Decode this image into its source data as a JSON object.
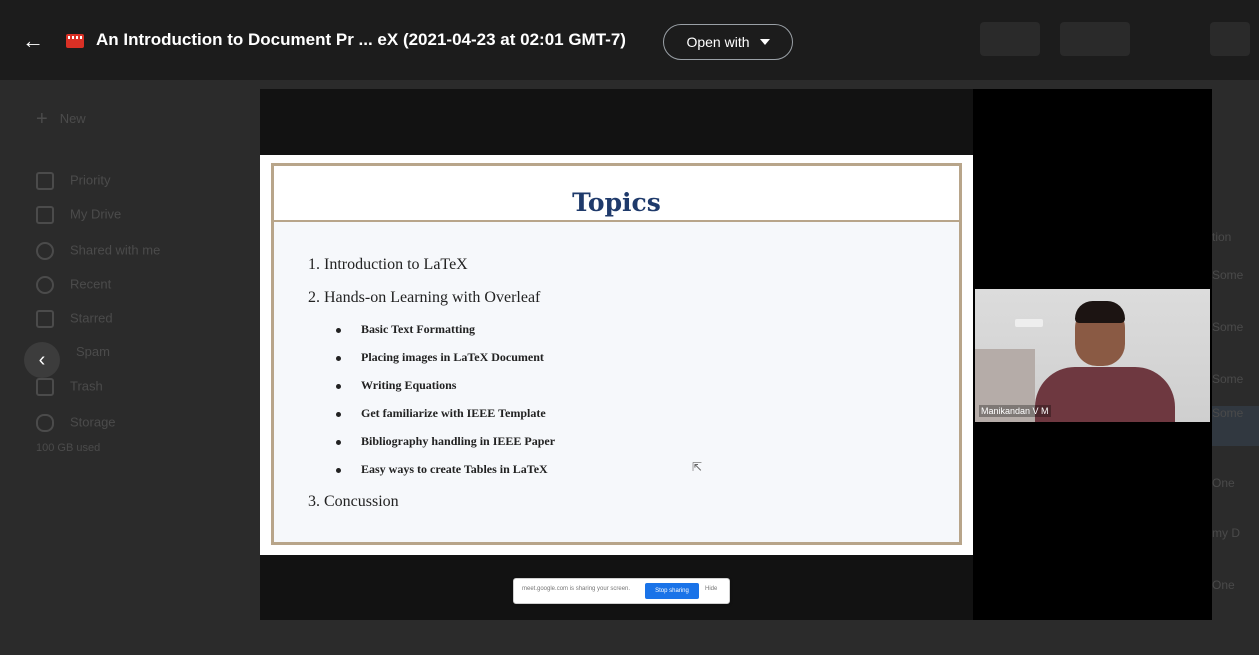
{
  "topbar": {
    "title": "An Introduction to Document Pr ... eX (2021-04-23 at 02:01 GMT-7)",
    "open_with": "Open with"
  },
  "drive": {
    "new_label": "New",
    "nav": [
      "Priority",
      "My Drive",
      "Shared with me",
      "Recent",
      "Starred",
      "Spam",
      "Trash",
      "Storage"
    ],
    "storage_used": "100 GB used",
    "right_col": [
      "tion",
      "Some",
      "Some",
      "Some",
      "Some",
      "One",
      "my D",
      "One"
    ]
  },
  "slide": {
    "title": "Topics",
    "items": [
      {
        "text": "1.   Introduction to LaTeX",
        "level": 1
      },
      {
        "text": "2.   Hands-on Learning with Overleaf",
        "level": 1
      },
      {
        "text": "Basic Text Formatting",
        "level": 2
      },
      {
        "text": "Placing images in LaTeX Document",
        "level": 2
      },
      {
        "text": "Writing Equations",
        "level": 2
      },
      {
        "text": "Get familiarize with IEEE Template",
        "level": 2
      },
      {
        "text": "Bibliography handling in IEEE Paper",
        "level": 2
      },
      {
        "text": "Easy ways to create Tables in LaTeX",
        "level": 2
      },
      {
        "text": "3. Concussion",
        "level": 1
      }
    ]
  },
  "sharebar": {
    "message": "meet.google.com is sharing your screen.",
    "stop_label": "Stop sharing",
    "hide_label": "Hide"
  },
  "webcam": {
    "participant_name": "Manikandan V M"
  },
  "colors": {
    "topbar": "#1c1c1c",
    "slide_title": "#1f3a6b",
    "slide_border": "#b8a58a",
    "stop_button": "#1a73e8",
    "file_icon": "#d93025"
  }
}
